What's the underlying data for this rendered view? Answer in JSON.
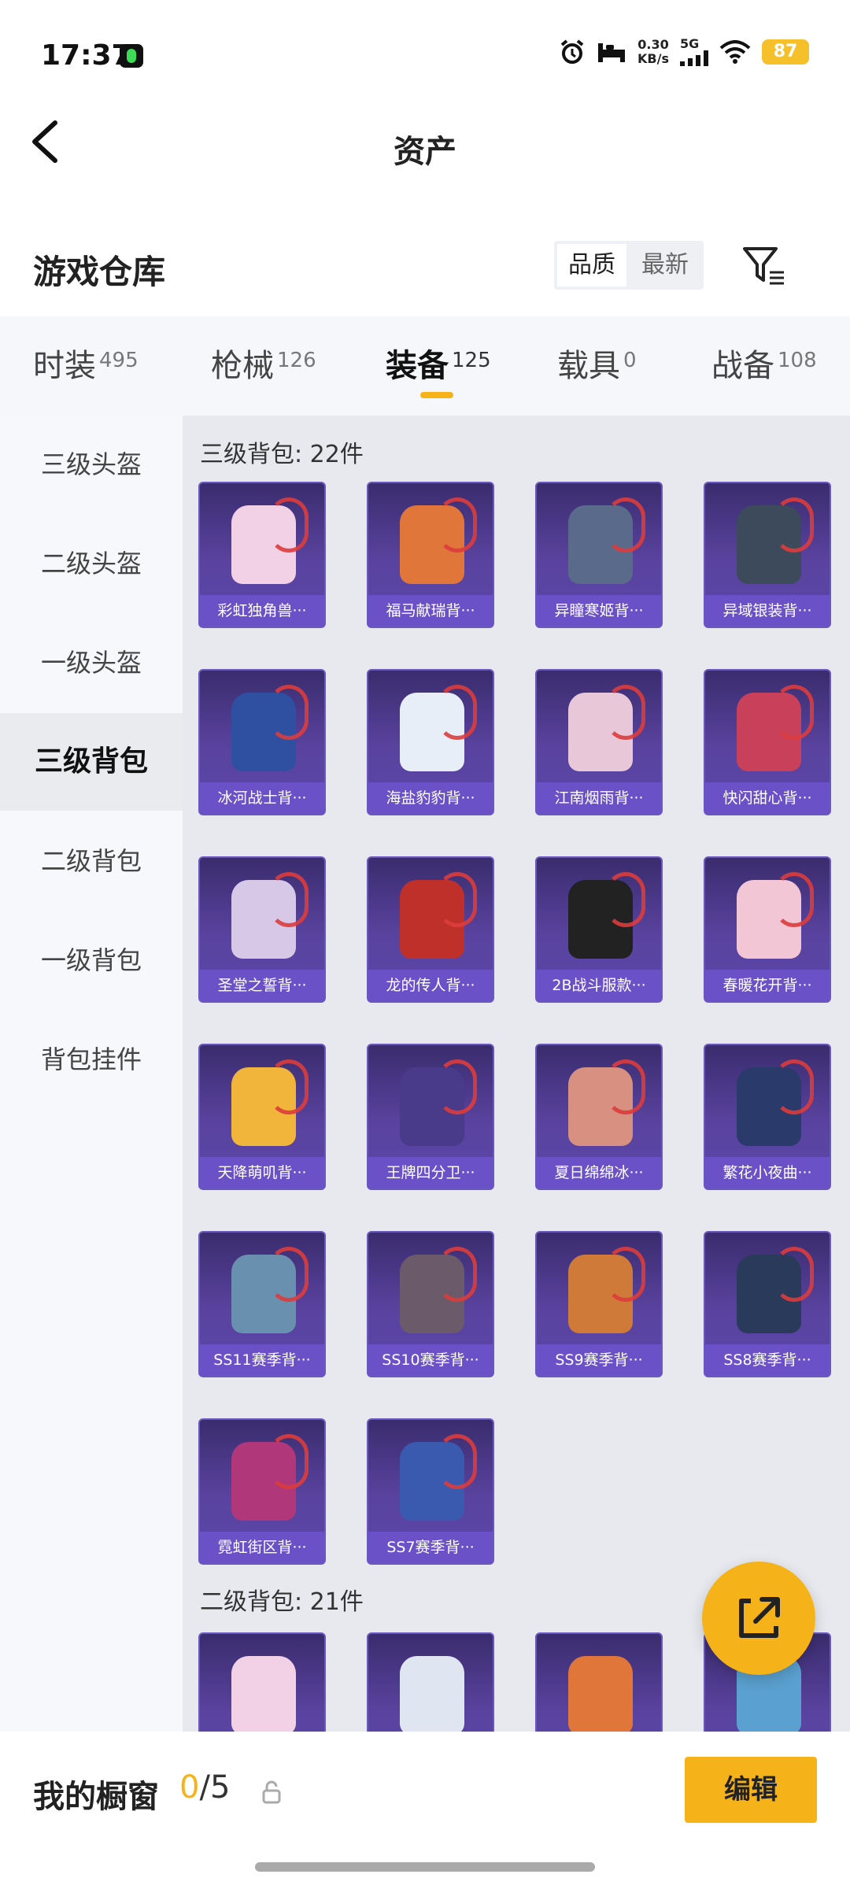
{
  "status": {
    "time": "17:37",
    "speed_value": "0.30",
    "speed_unit": "KB/s",
    "network": "5G",
    "battery": "87"
  },
  "header": {
    "title": "资产"
  },
  "section": {
    "title": "游戏仓库",
    "sort_quality": "品质",
    "sort_newest": "最新"
  },
  "tabs": [
    {
      "label": "时装",
      "count": "495"
    },
    {
      "label": "枪械",
      "count": "126"
    },
    {
      "label": "装备",
      "count": "125"
    },
    {
      "label": "载具",
      "count": "0"
    },
    {
      "label": "战备",
      "count": "108"
    }
  ],
  "sidebar": [
    "三级头盔",
    "二级头盔",
    "一级头盔",
    "三级背包",
    "二级背包",
    "一级背包",
    "背包挂件"
  ],
  "groups": [
    {
      "label": "三级背包: 22件",
      "items": [
        "彩虹独角兽···",
        "福马献瑞背···",
        "异瞳寒姬背···",
        "异域银装背···",
        "冰河战士背···",
        "海盐豹豹背···",
        "江南烟雨背···",
        "快闪甜心背···",
        "圣堂之誓背···",
        "龙的传人背···",
        "2B战斗服款···",
        "春暖花开背···",
        "天降萌叽背···",
        "王牌四分卫···",
        "夏日绵绵冰···",
        "繁花小夜曲···",
        "SS11赛季背···",
        "SS10赛季背···",
        "SS9赛季背···",
        "SS8赛季背···",
        "霓虹街区背···",
        "SS7赛季背···"
      ]
    },
    {
      "label": "二级背包: 21件"
    }
  ],
  "bottom": {
    "label": "我的橱窗",
    "current": "0",
    "separator": "/",
    "max": "5",
    "edit": "编辑"
  },
  "colors": {
    "accent": "#f5b319",
    "card_bg": "#4b3b8f",
    "card_caption": "#6a51c8"
  }
}
